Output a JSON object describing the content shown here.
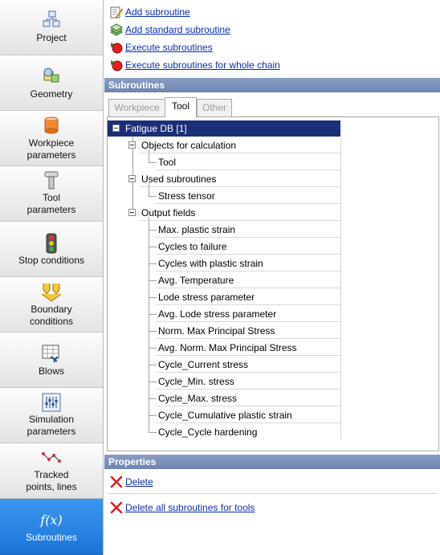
{
  "nav": {
    "items": [
      {
        "label1": "Project",
        "label2": "",
        "icon": "project-icon"
      },
      {
        "label1": "Geometry",
        "label2": "",
        "icon": "geometry-icon"
      },
      {
        "label1": "Workpiece",
        "label2": "parameters",
        "icon": "workpiece-icon"
      },
      {
        "label1": "Tool",
        "label2": "parameters",
        "icon": "tool-icon"
      },
      {
        "label1": "Stop conditions",
        "label2": "",
        "icon": "traffic-light-icon"
      },
      {
        "label1": "Boundary",
        "label2": "conditions",
        "icon": "boundary-arrows-icon"
      },
      {
        "label1": "Blows",
        "label2": "",
        "icon": "blows-icon"
      },
      {
        "label1": "Simulation",
        "label2": "parameters",
        "icon": "sliders-icon"
      },
      {
        "label1": "Tracked",
        "label2": "points, lines",
        "icon": "tracked-points-icon"
      },
      {
        "label1": "Subroutines",
        "label2": "",
        "icon": "function-icon",
        "glyph": "f(x)"
      }
    ],
    "active_index": 9
  },
  "actions": {
    "add_subroutine": "Add subroutine",
    "add_standard_subroutine": "Add standard subroutine",
    "execute_subroutines": "Execute subroutines",
    "execute_whole_chain": "Execute subroutines for whole chain"
  },
  "subroutines": {
    "header": "Subroutines",
    "tabs": [
      "Workpiece",
      "Tool",
      "Other"
    ],
    "active_tab": "Tool",
    "tree": {
      "root": "Fatigue DB [1]",
      "groups": [
        {
          "label": "Objects for calculation",
          "children": [
            "Tool"
          ]
        },
        {
          "label": "Used subroutines",
          "children": [
            "Stress tensor"
          ]
        },
        {
          "label": "Output fields",
          "children": [
            "Max. plastic strain",
            "Cycles to failure",
            "Cycles with plastic strain",
            "Avg. Temperature",
            "Lode stress parameter",
            "Avg. Lode stress parameter",
            "Norm. Max Principal Stress",
            "Avg. Norm. Max Principal Stress",
            "Cycle_Current stress",
            "Cycle_Min. stress",
            "Cycle_Max. stress",
            "Cycle_Cumulative plastic strain",
            "Cycle_Cycle hardening"
          ]
        }
      ]
    }
  },
  "properties": {
    "header": "Properties",
    "delete": "Delete",
    "delete_all": "Delete all subroutines for tools"
  }
}
